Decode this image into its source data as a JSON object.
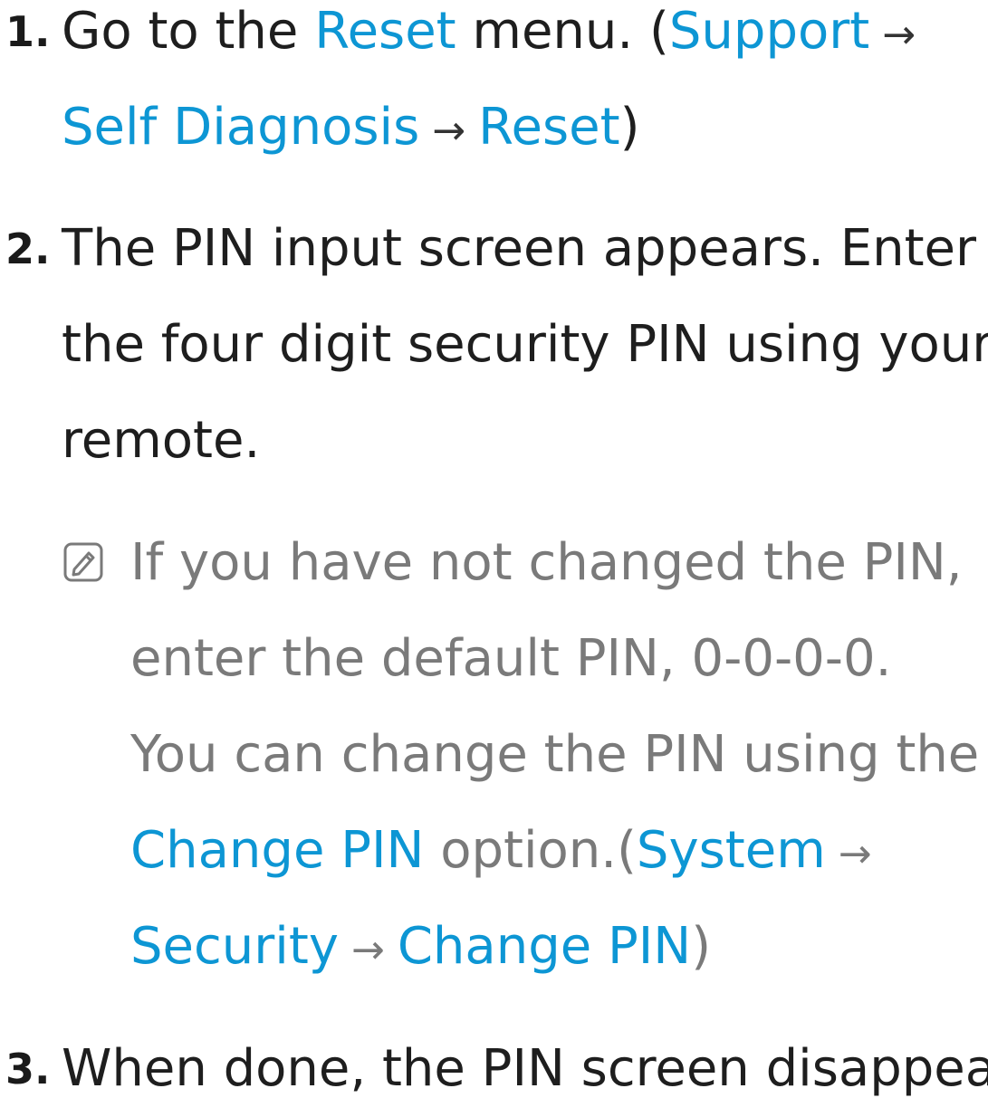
{
  "steps": [
    {
      "number": "1.",
      "lines": [
        [
          "Go to the ",
          "Reset",
          " menu. (",
          "Support",
          " →"
        ],
        [
          "Self Diagnosis",
          " → ",
          "Reset",
          ")"
        ]
      ]
    },
    {
      "number": "2.",
      "lines": [
        [
          "The PIN input screen appears. Enter"
        ],
        [
          "the four digit security PIN using your"
        ],
        [
          "remote."
        ]
      ]
    },
    {
      "number": "3.",
      "lines": [
        [
          "When done, the PIN screen disappear."
        ]
      ]
    }
  ],
  "note": {
    "icon": "note-pencil-icon",
    "lines": [
      [
        "If you have not changed the PIN,"
      ],
      [
        "enter the default PIN, 0-0-0-0."
      ],
      [
        "You can change the PIN using the"
      ],
      [
        "Change PIN",
        " option.(",
        "System",
        " →"
      ],
      [
        "Security",
        " → ",
        "Change PIN",
        ")"
      ]
    ]
  },
  "colors": {
    "accent": "#0d96d4",
    "body_text": "#1e1e1e",
    "note_text": "#7a7a7a"
  }
}
